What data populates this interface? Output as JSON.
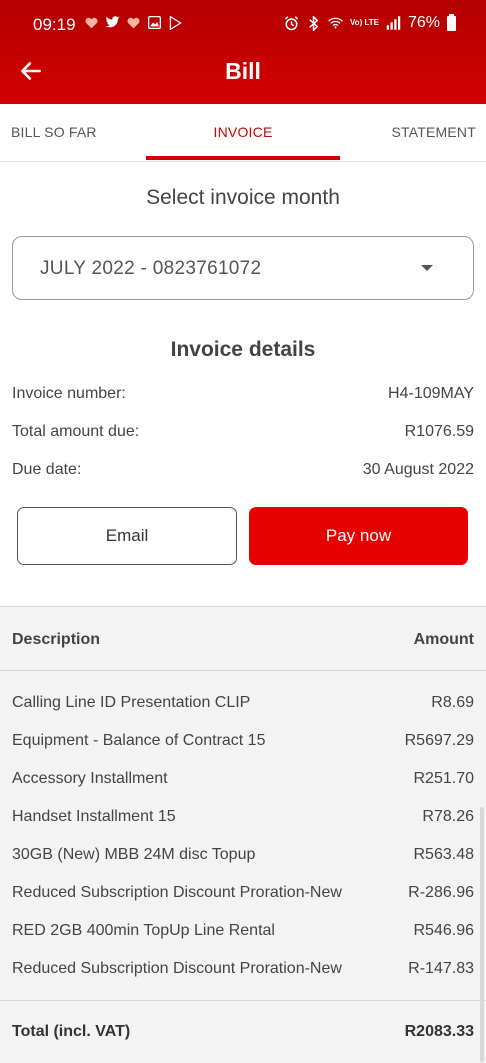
{
  "status_bar": {
    "time": "09:19",
    "battery": "76%",
    "lte_label": "Vo) LTE",
    "left_icons": [
      "heart-icon",
      "twitter-icon",
      "heart-icon",
      "gallery-icon",
      "play-store-icon"
    ],
    "right_icons": [
      "alarm-icon",
      "bluetooth-icon",
      "wifi-icon",
      "signal-icon",
      "battery-icon"
    ]
  },
  "header": {
    "title": "Bill",
    "back_icon": "arrow-left-icon"
  },
  "tabs": [
    {
      "label": "BILL SO FAR",
      "active": false
    },
    {
      "label": "INVOICE",
      "active": true
    },
    {
      "label": "STATEMENT",
      "active": false
    }
  ],
  "select": {
    "title": "Select invoice month",
    "value": "JULY 2022 - 0823761072"
  },
  "details": {
    "title": "Invoice details",
    "rows": [
      {
        "label": "Invoice number:",
        "value": "H4-109MAY"
      },
      {
        "label": "Total amount due:",
        "value": "R1076.59"
      },
      {
        "label": "Due date:",
        "value": "30 August 2022"
      }
    ]
  },
  "buttons": {
    "email": "Email",
    "pay": "Pay now"
  },
  "table": {
    "header": {
      "description": "Description",
      "amount": "Amount"
    },
    "rows": [
      {
        "description": "Calling Line ID Presentation CLIP",
        "amount": "R8.69"
      },
      {
        "description": "Equipment - Balance of Contract 15",
        "amount": "R5697.29"
      },
      {
        "description": "Accessory Installment",
        "amount": "R251.70"
      },
      {
        "description": "Handset Installment 15",
        "amount": "R78.26"
      },
      {
        "description": "30GB (New) MBB 24M disc Topup",
        "amount": "R563.48"
      },
      {
        "description": "Reduced Subscription Discount Proration-New",
        "amount": "R-286.96"
      },
      {
        "description": "RED 2GB 400min TopUp Line Rental",
        "amount": "R546.96"
      },
      {
        "description": "Reduced Subscription Discount Proration-New",
        "amount": "R-147.83"
      }
    ],
    "total": {
      "label": "Total (incl. VAT)",
      "amount": "R2083.33"
    }
  },
  "colors": {
    "brand_red": "#e60000",
    "header_red": "#c00000",
    "tab_active": "#cc0000"
  }
}
